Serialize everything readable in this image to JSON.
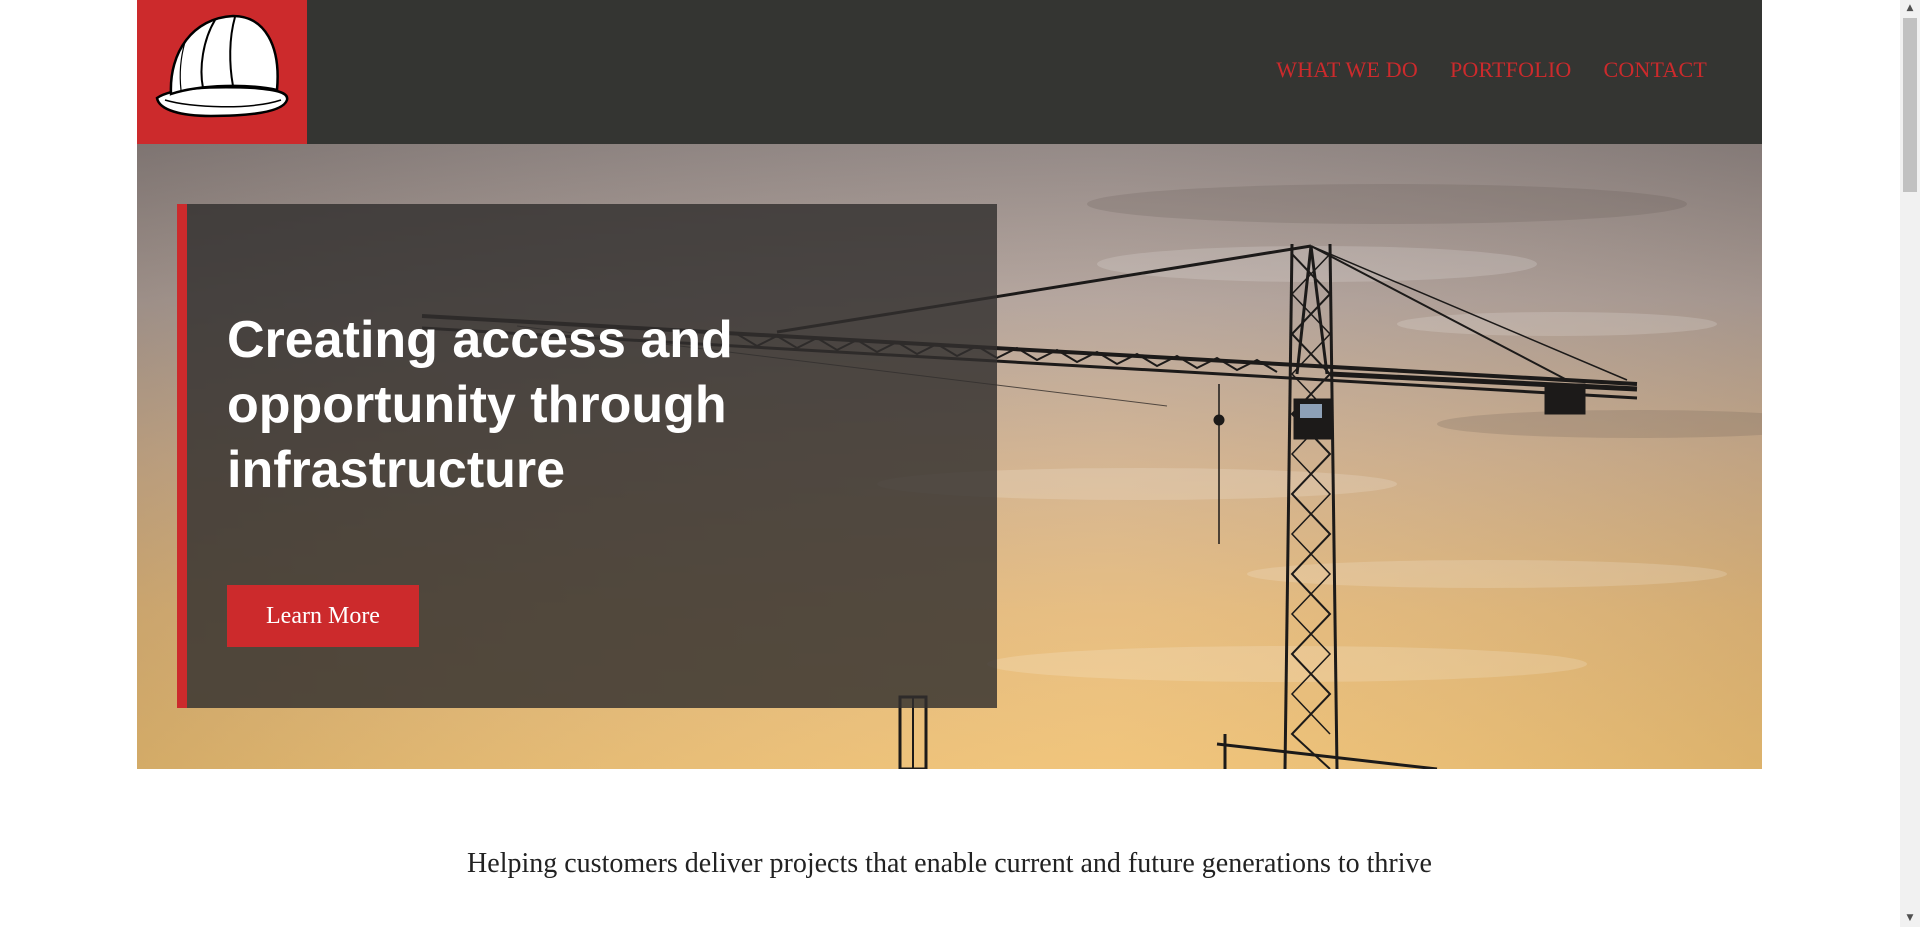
{
  "header": {
    "logo_icon": "hard-hat-icon",
    "nav": [
      {
        "label": "WHAT WE DO"
      },
      {
        "label": "PORTFOLIO"
      },
      {
        "label": "CONTACT"
      }
    ]
  },
  "hero": {
    "title": "Creating access and opportunity through infrastructure",
    "button_label": "Learn More",
    "background": "construction crane silhouette at sunset"
  },
  "tagline": "Helping customers deliver projects that enable current and future generations to thrive",
  "colors": {
    "brand_red": "#cc2a2c",
    "header_bg": "#343532",
    "panel_bg": "#32302e"
  }
}
